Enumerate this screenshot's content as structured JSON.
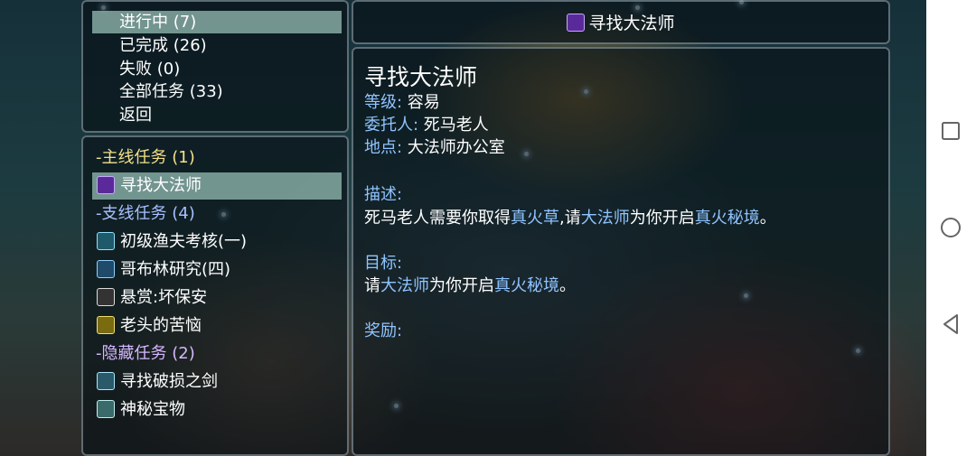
{
  "menu": {
    "items": [
      {
        "label": "进行中 (7)"
      },
      {
        "label": "已完成 (26)"
      },
      {
        "label": "失败 (0)"
      },
      {
        "label": "全部任务 (33)"
      },
      {
        "label": "返回"
      }
    ]
  },
  "quests": {
    "main_category": "-主线任务 (1)",
    "main_items": [
      {
        "label": "寻找大法师",
        "icon": "wizard-icon"
      }
    ],
    "side_category": "-支线任务 (4)",
    "side_items": [
      {
        "label": "初级渔夫考核(一)",
        "icon": "fishing-rod-icon"
      },
      {
        "label": "哥布林研究(四)",
        "icon": "magnifier-icon"
      },
      {
        "label": "悬赏:坏保安",
        "icon": "skull-icon"
      },
      {
        "label": "老头的苦恼",
        "icon": "scroll-icon"
      }
    ],
    "hidden_category": "-隐藏任务 (2)",
    "hidden_items": [
      {
        "label": "寻找破损之剑",
        "icon": "sword-icon"
      },
      {
        "label": "神秘宝物",
        "icon": "treasure-icon"
      }
    ]
  },
  "detail": {
    "title_bar": "寻找大法师",
    "heading": "寻找大法师",
    "level_label": "等级:",
    "level_value": " 容易",
    "client_label": "委托人:",
    "client_value": " 死马老人",
    "location_label": "地点:",
    "location_value": " 大法师办公室",
    "desc_label": "描述:",
    "desc_parts": [
      "死马老人需要你取得",
      "真火草",
      ",请",
      "大法师",
      "为你开启",
      "真火秘境",
      "。"
    ],
    "goal_label": "目标:",
    "goal_parts": [
      "请",
      "大法师",
      "为你开启",
      "真火秘境",
      "。"
    ],
    "reward_label": "奖励:"
  },
  "colors": {
    "highlight": "#8fc4ff",
    "main_category": "#f3e08a",
    "selected_bg": "#96beb4"
  },
  "system_nav": {
    "icons": [
      "recent-apps-icon",
      "home-icon",
      "back-icon"
    ]
  }
}
